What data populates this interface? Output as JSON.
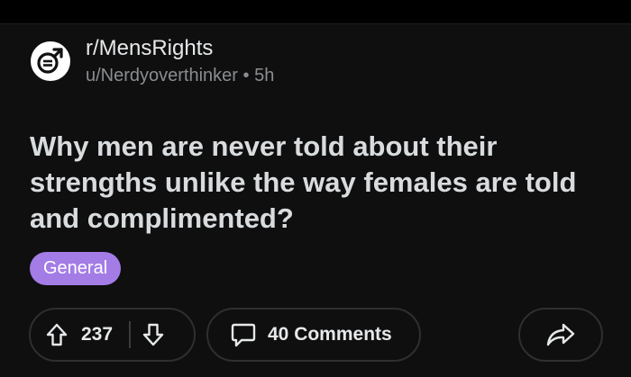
{
  "post": {
    "subreddit": "r/MensRights",
    "author": "u/Nerdyoverthinker",
    "separator": "•",
    "age": "5h",
    "title": "Why men are never told about their strengths unlike the way females are told and complimented?",
    "flair": "General"
  },
  "actions": {
    "vote_count": "237",
    "comments_label": "40 Comments"
  },
  "colors": {
    "flair_bg": "#a37ce6",
    "card_bg": "#0f0f0f"
  },
  "icons": {
    "avatar": "mens-symbol-icon",
    "upvote": "arrow-up-icon",
    "downvote": "arrow-down-icon",
    "comment": "speech-bubble-icon",
    "share": "share-arrow-icon"
  }
}
